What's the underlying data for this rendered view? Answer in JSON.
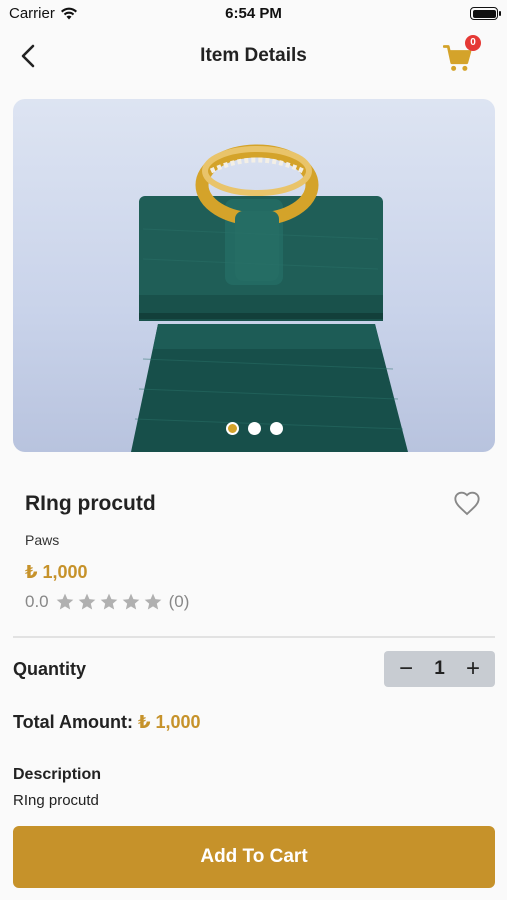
{
  "status_bar": {
    "carrier": "Carrier",
    "time": "6:54 PM"
  },
  "nav": {
    "title": "Item Details",
    "cart_count": "0"
  },
  "gallery": {
    "slide_count": 3,
    "active_index": 0
  },
  "product": {
    "name": "RIng procutd",
    "brand": "Paws",
    "price": "₺ 1,000",
    "rating": "0.0",
    "rating_max_stars": 5,
    "review_count": "(0)"
  },
  "quantity": {
    "label": "Quantity",
    "minus": "−",
    "value": "1",
    "plus": "+"
  },
  "total": {
    "label": "Total Amount:",
    "value": "₺ 1,000"
  },
  "description": {
    "title": "Description",
    "text": "RIng procutd"
  },
  "add_to_cart": {
    "label": "Add To Cart"
  },
  "colors": {
    "accent": "#c6922a",
    "badge": "#e53935",
    "star": "#b0b0b0"
  }
}
